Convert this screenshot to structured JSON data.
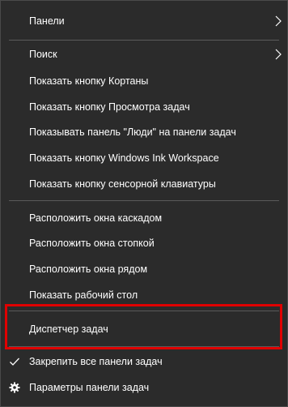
{
  "context_menu": {
    "items": [
      {
        "label": "Панели",
        "submenu": true
      },
      {
        "label": "Поиск",
        "submenu": true
      },
      {
        "label": "Показать кнопку Кортаны"
      },
      {
        "label": "Показать кнопку Просмотра задач"
      },
      {
        "label": "Показывать панель \"Люди\" на панели задач"
      },
      {
        "label": "Показать кнопку Windows Ink Workspace"
      },
      {
        "label": "Показать кнопку сенсорной клавиатуры"
      },
      {
        "label": "Расположить окна каскадом"
      },
      {
        "label": "Расположить окна стопкой"
      },
      {
        "label": "Расположить окна рядом"
      },
      {
        "label": "Показать рабочий стол"
      },
      {
        "label": "Диспетчер задач",
        "highlighted": true
      },
      {
        "label": "Закрепить все панели задач",
        "icon": "checkmark-icon",
        "checked": true
      },
      {
        "label": "Параметры панели задач",
        "icon": "gear-icon"
      }
    ]
  },
  "colors": {
    "menu_background": "#2b2b2b",
    "text": "#ffffff",
    "separator": "#5a5a5a",
    "highlight_border": "#e00000"
  }
}
